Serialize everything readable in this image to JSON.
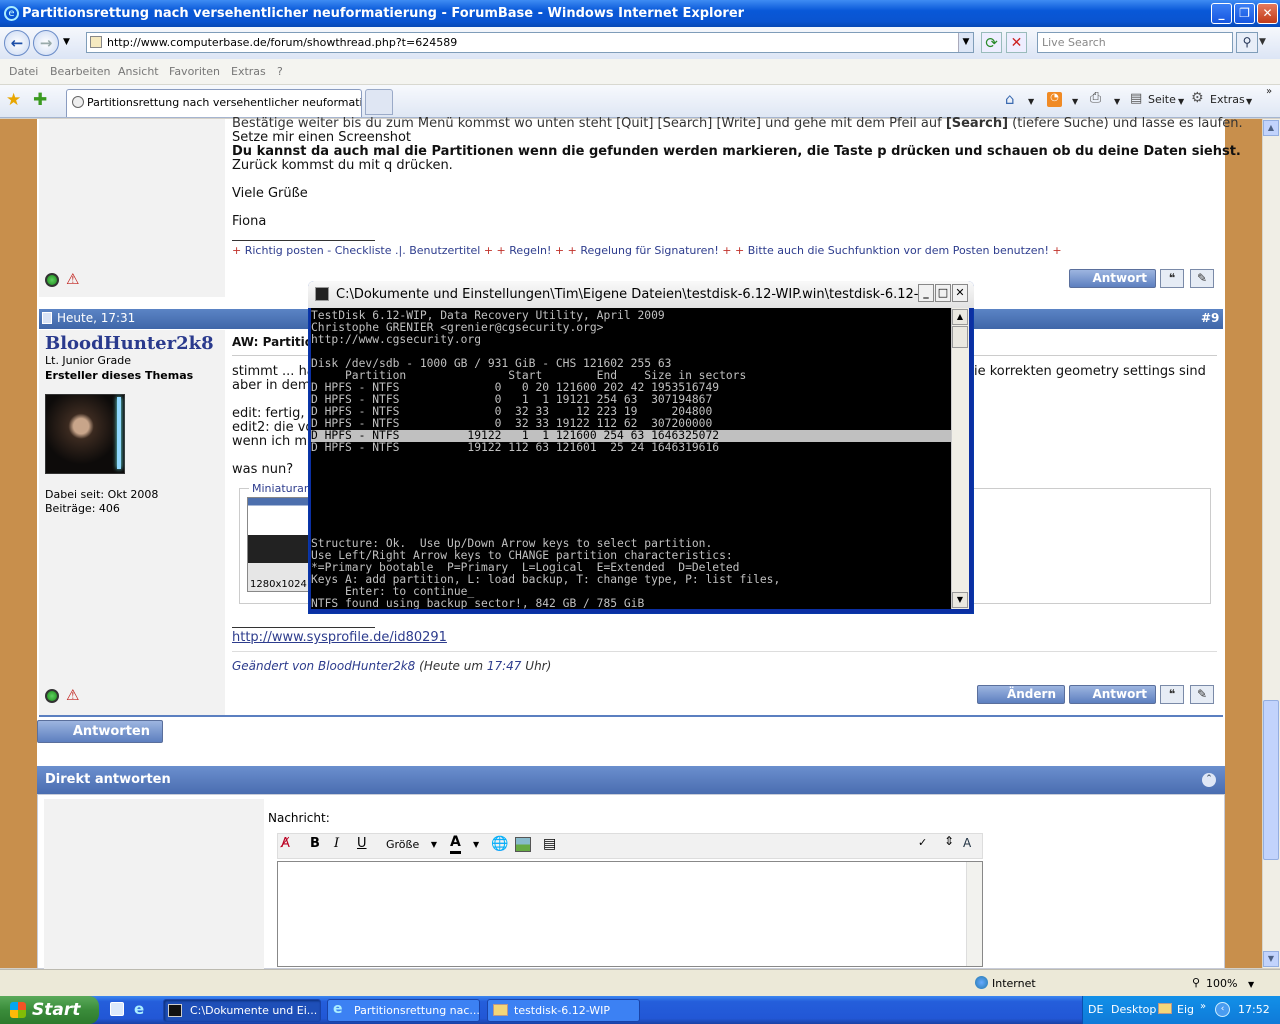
{
  "window": {
    "title": "Partitionsrettung nach versehentlicher neuformatierung - ForumBase - Windows Internet Explorer"
  },
  "nav": {
    "url": "http://www.computerbase.de/forum/showthread.php?t=624589",
    "search_placeholder": "Live Search"
  },
  "menu": [
    "Datei",
    "Bearbeiten",
    "Ansicht",
    "Favoriten",
    "Extras",
    "?"
  ],
  "tab": {
    "title": "Partitionsrettung nach versehentlicher neuformatieru..."
  },
  "commandbar": {
    "seite": "Seite",
    "extras": "Extras"
  },
  "post1": {
    "line1": "Bestätige weiter bis du zum Menü kommst wo unten steht [Quit] [Search] [Write] und gehe mit dem Pfeil auf",
    "line1_bold": "[Search]",
    "line1_end": "(tiefere Suche) und lasse es laufen.",
    "line2": "Setze mir einen Screenshot",
    "line3": "Du kannst da auch mal die Partitionen wenn die gefunden werden markieren, die Taste p drücken und schauen ob du deine Daten siehst.",
    "line4": "Zurück kommst du mit q drücken.",
    "greeting": "Viele Grüße",
    "name": "Fiona",
    "sig": [
      {
        "text": "Richtig posten - Checkliste .|. Benutzertitel"
      },
      {
        "text": "Regeln!"
      },
      {
        "text": "Regelung für Signaturen!"
      },
      {
        "text": "Bitte auch die Suchfunktion vor dem Posten benutzen!"
      }
    ],
    "reply_button": "Antwort"
  },
  "post2": {
    "date": "Heute, 17:31",
    "number": "#9",
    "username": "BloodHunter2k8",
    "rank": "Lt. Junior Grade",
    "role": "Ersteller dieses Themas",
    "joined": "Dabei seit: Okt 2008",
    "posts": "Beiträge: 406",
    "title": "AW: Partitio",
    "body1": "stimmt ... ha",
    "body1_end": "ie korrekten geometry settings sind",
    "body2": "aber in dem",
    "body3": "edit: fertig,",
    "body4": "edit2: die vo",
    "body5": "wenn ich mi",
    "body6": "was nun?",
    "thumb_label": "Miniaturans",
    "thumb_size": "1280x1024",
    "sig_link": "http://www.sysprofile.de/id80291",
    "edited_prefix": "Geändert von BloodHunter2k8",
    "edited_time_a": "(Heute um",
    "edited_time": "17:47",
    "edited_time_b": "Uhr)",
    "edit_button": "Ändern",
    "reply_button": "Antwort"
  },
  "antworten_button": "Antworten",
  "quick_reply": {
    "title": "Direkt antworten",
    "label": "Nachricht:",
    "size_select": "Größe"
  },
  "console": {
    "title": "C:\\Dokumente und Einstellungen\\Tim\\Eigene Dateien\\testdisk-6.12-WIP.win\\testdisk-6.12-...",
    "lines": [
      "TestDisk 6.12-WIP, Data Recovery Utility, April 2009",
      "Christophe GRENIER <grenier@cgsecurity.org>",
      "http://www.cgsecurity.org",
      "",
      "Disk /dev/sdb - 1000 GB / 931 GiB - CHS 121602 255 63",
      "     Partition               Start        End    Size in sectors",
      "D HPFS - NTFS              0   0 20 121600 202 42 1953516749",
      "D HPFS - NTFS              0   1  1 19121 254 63  307194867",
      "D HPFS - NTFS              0  32 33    12 223 19     204800",
      "D HPFS - NTFS              0  32 33 19122 112 62  307200000",
      "D HPFS - NTFS          19122   1  1 121600 254 63 1646325072",
      "D HPFS - NTFS          19122 112 63 121601  25 24 1646319616",
      "",
      "",
      "",
      "",
      "",
      "",
      "",
      "Structure: Ok.  Use Up/Down Arrow keys to select partition.",
      "Use Left/Right Arrow keys to CHANGE partition characteristics:",
      "*=Primary bootable  P=Primary  L=Logical  E=Extended  D=Deleted",
      "Keys A: add partition, L: load backup, T: change type, P: list files,",
      "     Enter: to continue_",
      "NTFS found using backup sector!, 842 GB / 785 GiB"
    ],
    "highlight_line": 10
  },
  "statusbar": {
    "zone": "Internet",
    "zoom": "100%"
  },
  "taskbar": {
    "start": "Start",
    "tasks": [
      "C:\\Dokumente und Ei...",
      "Partitionsrettung nac...",
      "testdisk-6.12-WIP"
    ],
    "tray_desktop": "Desktop",
    "tray_lang": "DE",
    "tray_eig": "Eig",
    "clock": "17:52"
  }
}
